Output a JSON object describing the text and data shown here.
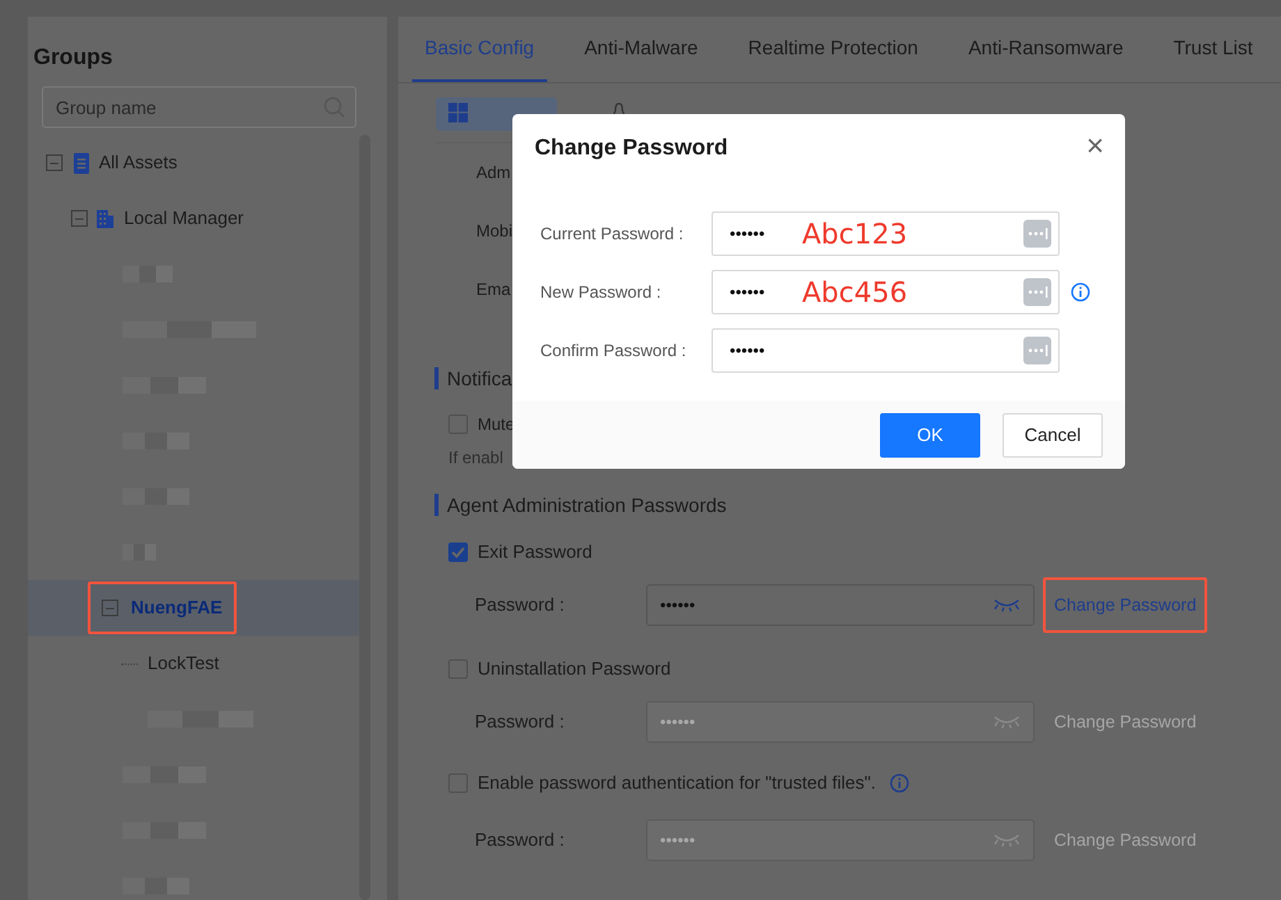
{
  "sidebar": {
    "title": "Groups",
    "search": {
      "placeholder": "Group name"
    },
    "tree": [
      {
        "kind": "group",
        "label": "All Assets",
        "expanded": true,
        "selected": false,
        "children": [
          {
            "kind": "group",
            "label": "Local Manager",
            "expanded": true,
            "selected": false,
            "children": [
              {
                "kind": "redacted"
              },
              {
                "kind": "redacted"
              },
              {
                "kind": "redacted"
              },
              {
                "kind": "redacted"
              },
              {
                "kind": "redacted"
              },
              {
                "kind": "redacted"
              },
              {
                "kind": "group",
                "label": "NuengFAE",
                "expanded": true,
                "selected": true,
                "highlighted": true,
                "children": [
                  {
                    "kind": "leaf",
                    "label": "LockTest",
                    "selected": false
                  },
                  {
                    "kind": "redacted"
                  }
                ]
              },
              {
                "kind": "redacted"
              },
              {
                "kind": "redacted"
              },
              {
                "kind": "redacted"
              }
            ]
          }
        ]
      }
    ]
  },
  "tabs": [
    {
      "label": "Basic Config",
      "selected": true
    },
    {
      "label": "Anti-Malware",
      "selected": false
    },
    {
      "label": "Realtime Protection",
      "selected": false
    },
    {
      "label": "Anti-Ransomware",
      "selected": false
    },
    {
      "label": "Trust List",
      "selected": false
    }
  ],
  "os_tabs": [
    {
      "selected": true
    },
    {
      "selected": false
    }
  ],
  "partial_fields": [
    "Adm",
    "Mobi",
    "Ema"
  ],
  "notification": {
    "title": "Notifica",
    "option": {
      "label": "Mute",
      "checked": false
    },
    "hint": "If enabl"
  },
  "agent_passwords": {
    "title": "Agent Administration Passwords",
    "items": [
      {
        "label": "Exit Password",
        "checked": true,
        "info": false,
        "field_label": "Password :",
        "value": "••••••",
        "link": "Change Password",
        "highlighted": true
      },
      {
        "label": "Uninstallation Password",
        "checked": false,
        "info": false,
        "field_label": "Password :",
        "value": "••••••",
        "link": "Change Password",
        "highlighted": false
      },
      {
        "label": "Enable password authentication for \"trusted files\".",
        "checked": false,
        "info": true,
        "field_label": "Password :",
        "value": "••••••",
        "link": "Change Password",
        "highlighted": false
      }
    ]
  },
  "dialog": {
    "title": "Change Password",
    "close": "×",
    "fields": [
      {
        "label": "Current Password :",
        "value": "••••••",
        "annotation": "Abc123",
        "info": false
      },
      {
        "label": "New Password :",
        "value": "••••••",
        "annotation": "Abc456",
        "info": true
      },
      {
        "label": "Confirm Password :",
        "value": "••••••",
        "info": false
      }
    ],
    "buttons": [
      {
        "label": "OK",
        "kind": "primary"
      },
      {
        "label": "Cancel",
        "kind": "default"
      }
    ]
  }
}
